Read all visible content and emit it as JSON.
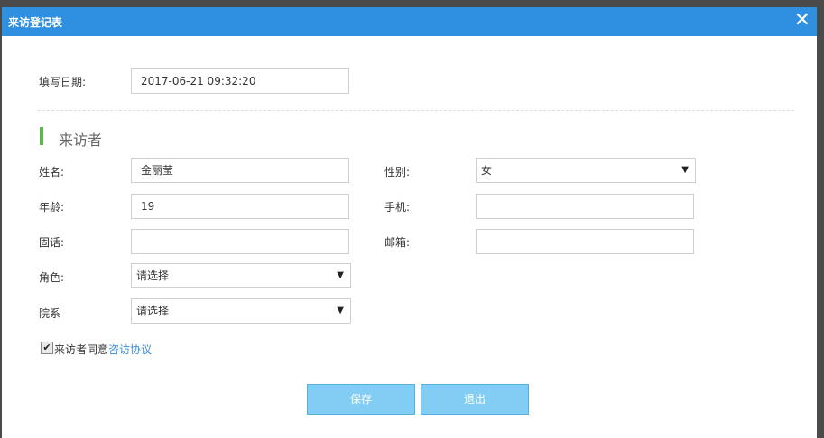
{
  "dialog": {
    "title": "来访登记表",
    "close_glyph": "✕"
  },
  "form": {
    "date_label": "填写日期:",
    "date_value": "2017-06-21 09:32:20",
    "section_title": "来访者",
    "name_label": "姓名:",
    "name_value": "金丽莹",
    "gender_label": "性别:",
    "gender_value": "女",
    "age_label": "年龄:",
    "age_value": "19",
    "phone_label": "手机:",
    "phone_value": "",
    "landline_label": "固话:",
    "landline_value": "",
    "email_label": "邮箱:",
    "email_value": "",
    "role_label": "角色:",
    "role_value": "请选择",
    "dept_label": "院系",
    "dept_value": "请选择",
    "agree_checked": true,
    "agree_text": "来访者同意",
    "agree_link": "咨访协议"
  },
  "buttons": {
    "save": "保存",
    "exit": "退出"
  },
  "colors": {
    "titlebar": "#2f8fe0",
    "section_accent": "#5db84a",
    "button": "#82cdf4",
    "link": "#3a8ed6"
  }
}
